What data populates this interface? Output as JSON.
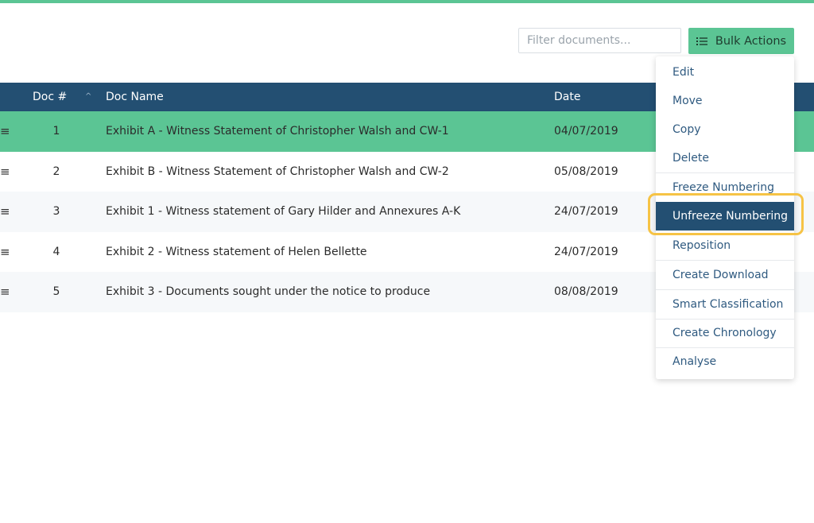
{
  "toolbar": {
    "filter_placeholder": "Filter documents...",
    "bulk_actions_label": "Bulk Actions",
    "bulk_actions_icon": "list-icon"
  },
  "table": {
    "headers": {
      "doc_num": "Doc #",
      "doc_name": "Doc Name",
      "date": "Date"
    },
    "sort_icon": "chevron-up-icon",
    "drag_glyph": "≡",
    "rows": [
      {
        "num": "1",
        "name": "Exhibit A - Witness Statement of Christopher Walsh and CW-1",
        "date": "04/07/2019",
        "selected": true
      },
      {
        "num": "2",
        "name": "Exhibit B - Witness Statement of Christopher Walsh and CW-2",
        "date": "05/08/2019",
        "selected": false
      },
      {
        "num": "3",
        "name": "Exhibit 1 - Witness statement of Gary Hilder and Annexures A-K",
        "date": "24/07/2019",
        "selected": false
      },
      {
        "num": "4",
        "name": "Exhibit 2 - Witness statement of Helen Bellette",
        "date": "24/07/2019",
        "selected": false
      },
      {
        "num": "5",
        "name": "Exhibit 3 - Documents sought under the notice to produce",
        "date": "08/08/2019",
        "selected": false
      }
    ]
  },
  "bulk_menu": {
    "items": [
      {
        "label": "Edit"
      },
      {
        "label": "Move"
      },
      {
        "label": "Copy"
      },
      {
        "label": "Delete"
      },
      {
        "label": "Freeze Numbering"
      },
      {
        "label": "Unfreeze Numbering",
        "active": true
      },
      {
        "label": "Reposition"
      },
      {
        "label": "Create Download"
      },
      {
        "label": "Smart Classification"
      },
      {
        "label": "Create Chronology"
      },
      {
        "label": "Analyse"
      }
    ]
  },
  "colors": {
    "accent_green": "#5bc594",
    "header_navy": "#234f72",
    "menu_text": "#2f5a80",
    "highlight_ring": "#f6c345"
  }
}
